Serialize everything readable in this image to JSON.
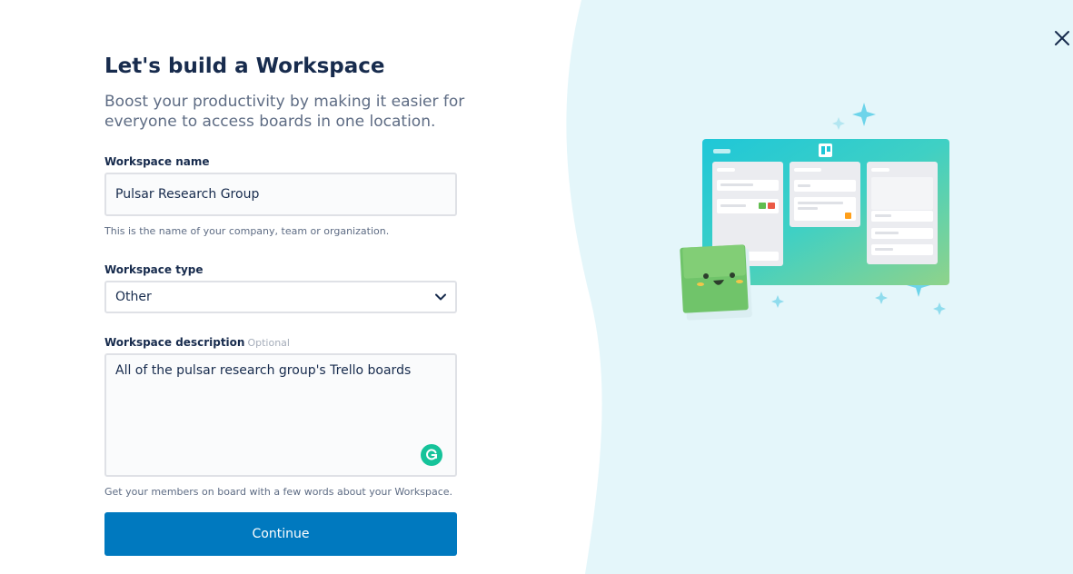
{
  "title": "Let's build a Workspace",
  "subtitle": "Boost your productivity by making it easier for everyone to access boards in one location.",
  "workspace_name": {
    "label": "Workspace name",
    "value": "Pulsar Research Group",
    "helper": "This is the name of your company, team or organization."
  },
  "workspace_type": {
    "label": "Workspace type",
    "selected": "Other"
  },
  "workspace_description": {
    "label": "Workspace description",
    "optional_tag": "Optional",
    "value": "All of the pulsar research group's Trello boards",
    "helper": "Get your members on board with a few words about your Workspace."
  },
  "continue_label": "Continue",
  "icons": {
    "close": "close-icon",
    "dropdown": "chevron-down-icon",
    "grammarly": "grammarly-icon"
  },
  "colors": {
    "primary_button": "#0079bf",
    "title": "#172b4d",
    "subtitle": "#5e6c84",
    "right_panel": "#e4f6fa",
    "grammarly": "#15c39a"
  }
}
